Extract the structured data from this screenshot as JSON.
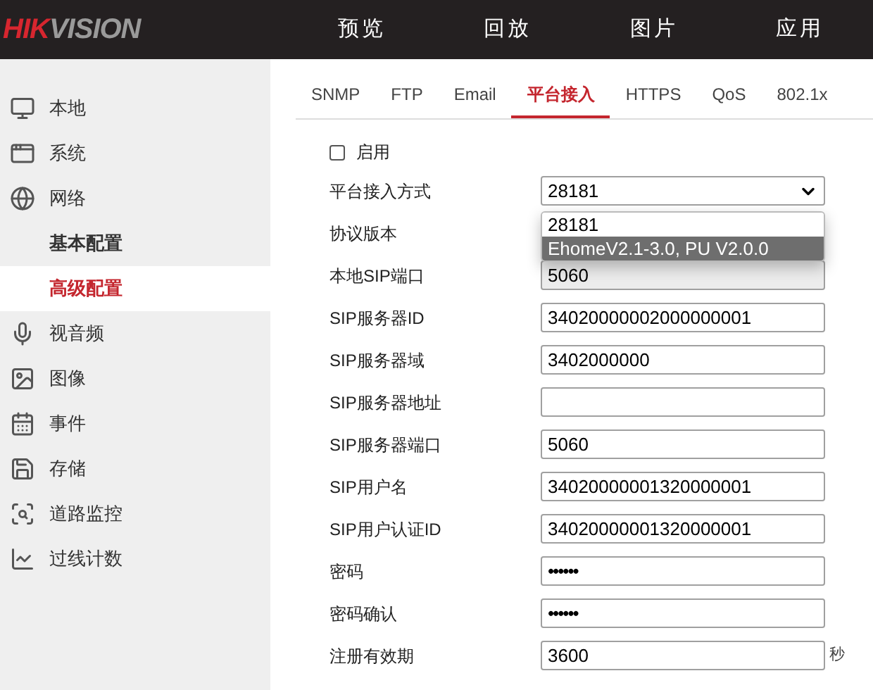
{
  "header": {
    "logo": {
      "red": "HIK",
      "grey": "VISION"
    },
    "nav": [
      {
        "label": "预览"
      },
      {
        "label": "回放"
      },
      {
        "label": "图片"
      },
      {
        "label": "应用"
      }
    ]
  },
  "sidebar": {
    "items": [
      {
        "label": "本地",
        "selected": false
      },
      {
        "label": "系统",
        "selected": false
      },
      {
        "label": "网络",
        "selected": false,
        "children": [
          {
            "label": "基本配置",
            "selected": false
          },
          {
            "label": "高级配置",
            "selected": true
          }
        ]
      },
      {
        "label": "视音频",
        "selected": false
      },
      {
        "label": "图像",
        "selected": false
      },
      {
        "label": "事件",
        "selected": false
      },
      {
        "label": "存储",
        "selected": false
      },
      {
        "label": "道路监控",
        "selected": false
      },
      {
        "label": "过线计数",
        "selected": false
      }
    ]
  },
  "tabs": [
    {
      "label": "SNMP",
      "selected": false
    },
    {
      "label": "FTP",
      "selected": false
    },
    {
      "label": "Email",
      "selected": false
    },
    {
      "label": "平台接入",
      "selected": true
    },
    {
      "label": "HTTPS",
      "selected": false
    },
    {
      "label": "QoS",
      "selected": false
    },
    {
      "label": "802.1x",
      "selected": false
    }
  ],
  "enable": {
    "label": "启用",
    "checked": false
  },
  "form": [
    {
      "kind": "select",
      "label": "平台接入方式",
      "value": "28181",
      "dropdown": [
        {
          "label": "28181",
          "highlighted": false
        },
        {
          "label": "EhomeV2.1-3.0, PU V2.0.0",
          "highlighted": true
        }
      ]
    },
    {
      "kind": "hidden",
      "label": "协议版本"
    },
    {
      "kind": "readonly",
      "label": "本地SIP端口",
      "value": "5060"
    },
    {
      "kind": "text",
      "label": "SIP服务器ID",
      "value": "34020000002000000001"
    },
    {
      "kind": "text",
      "label": "SIP服务器域",
      "value": "3402000000"
    },
    {
      "kind": "text",
      "label": "SIP服务器地址"
    },
    {
      "kind": "text",
      "label": "SIP服务器端口",
      "value": "5060"
    },
    {
      "kind": "text",
      "label": "SIP用户名",
      "value": "34020000001320000001"
    },
    {
      "kind": "text",
      "label": "SIP用户认证ID",
      "value": "34020000001320000001"
    },
    {
      "kind": "password",
      "label": "密码",
      "value": "••••••"
    },
    {
      "kind": "password",
      "label": "密码确认",
      "value": "••••••"
    },
    {
      "kind": "text",
      "label": "注册有效期",
      "value": "3600",
      "unit": "秒"
    }
  ]
}
